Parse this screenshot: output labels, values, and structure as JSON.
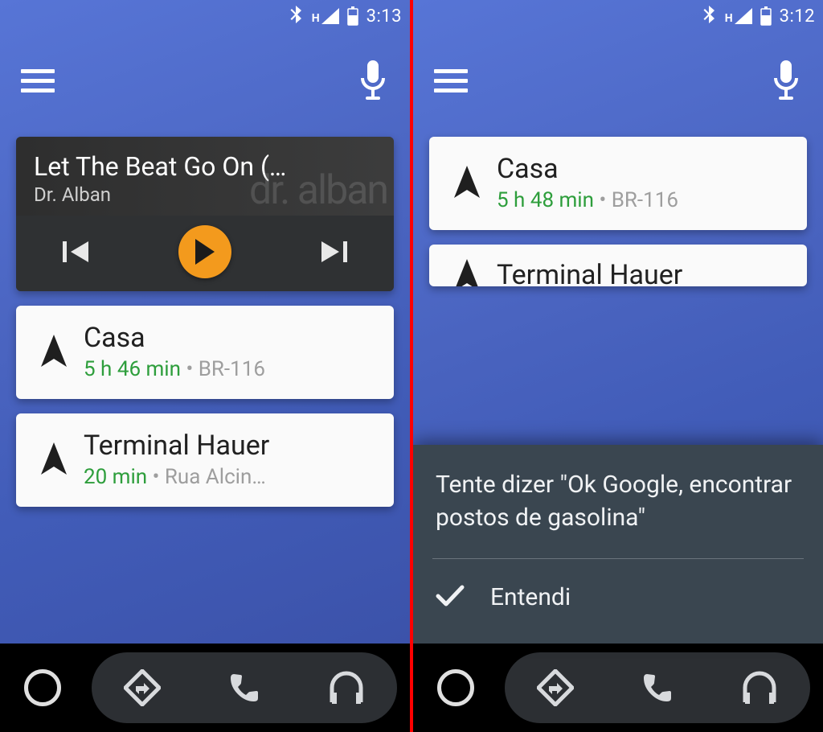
{
  "left": {
    "status": {
      "time": "3:13"
    },
    "music": {
      "title": "Let The Beat Go On (…",
      "artist": "Dr. Alban",
      "ghost": "dr. alban"
    },
    "nav": [
      {
        "title": "Casa",
        "eta": "5 h 46 min",
        "route": "BR-116"
      },
      {
        "title": "Terminal Hauer",
        "eta": "20 min",
        "route": "Rua Alcin…"
      }
    ]
  },
  "right": {
    "status": {
      "time": "3:12"
    },
    "nav": [
      {
        "title": "Casa",
        "eta": "5 h 48 min",
        "route": "BR-116"
      },
      {
        "title": "Terminal Hauer"
      }
    ],
    "tip": {
      "text": "Tente dizer \"Ok Google, encontrar postos de gasolina\"",
      "action": "Entendi"
    }
  }
}
